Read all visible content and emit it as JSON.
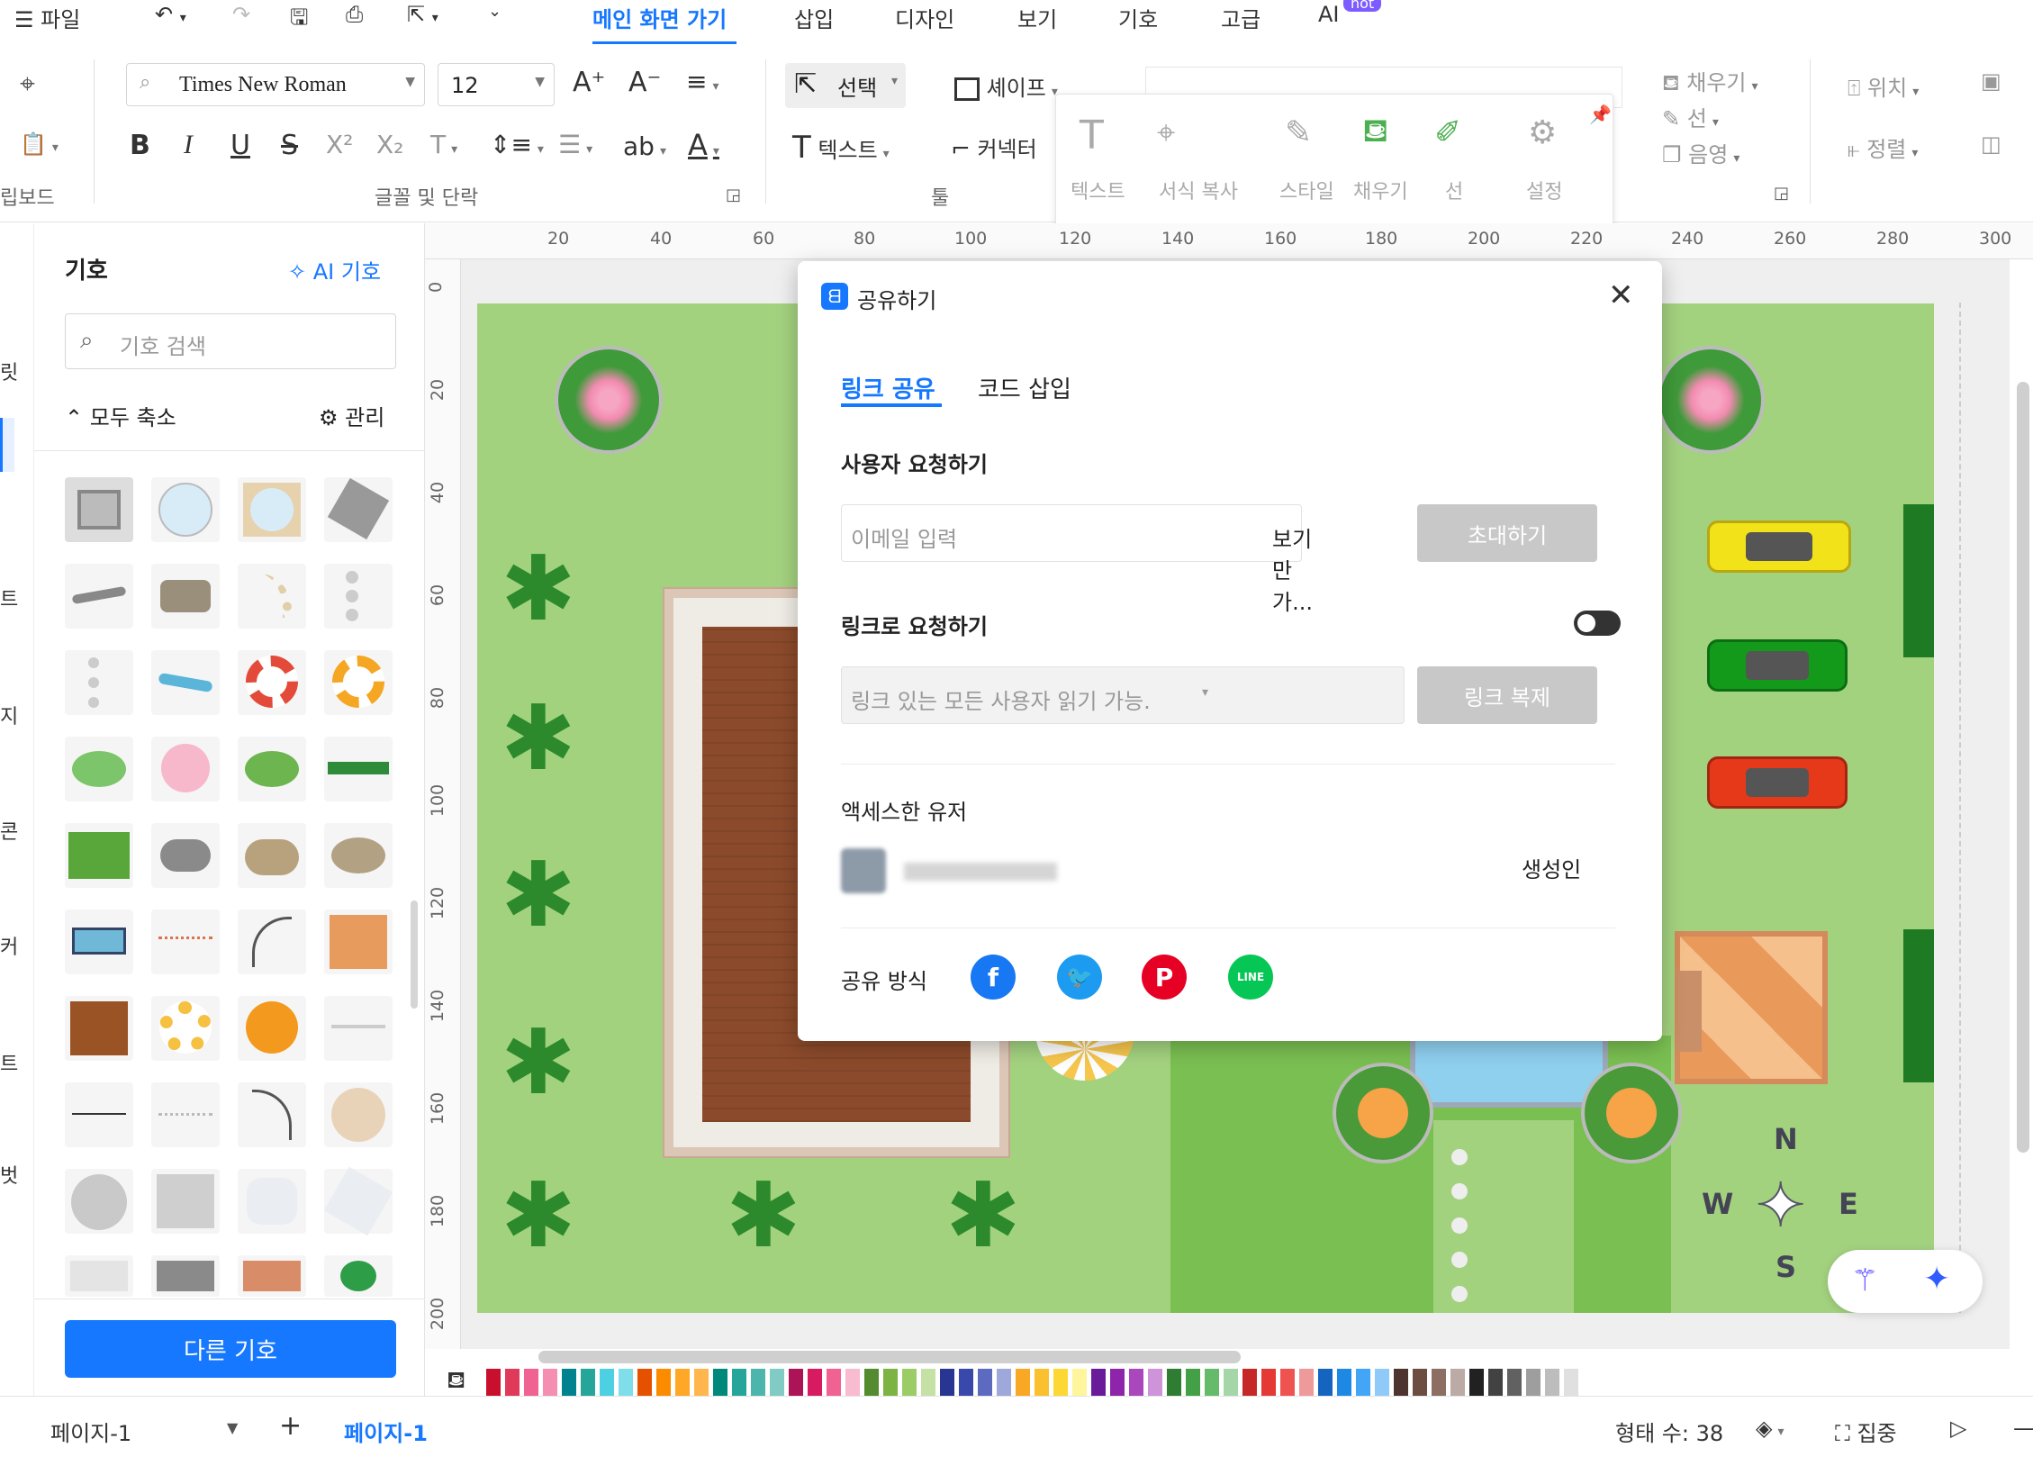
{
  "menu": {
    "file": "파일",
    "items": [
      "메인 화면 가기",
      "삽입",
      "디자인",
      "보기",
      "기호",
      "고급",
      "AI"
    ],
    "ai_badge": "hot"
  },
  "ribbon": {
    "font_family": "Times New Roman",
    "font_size": "12",
    "group_labels": [
      "립보드",
      "글꼴 및 단락",
      "툴"
    ],
    "select_label": "선택",
    "shape_label": "셰이프",
    "text_label": "텍스트",
    "connector_label": "커넥터",
    "fill_label": "채우기",
    "line_label": "선",
    "shadow_label": "음영",
    "position_label": "위치",
    "align_label": "정렬",
    "ab_label": "ab"
  },
  "quickbar": {
    "items": [
      "텍스트",
      "서식 복사",
      "스타일",
      "채우기",
      "선",
      "설정"
    ]
  },
  "left_panel": {
    "title": "기호",
    "ai_symbols": "AI 기호",
    "search_placeholder": "기호 검색",
    "collapse_all": "모두 축소",
    "manage": "관리",
    "more_symbols": "다른 기호",
    "strip_chars": [
      "릿",
      "트",
      "지",
      "콘",
      "커",
      "트",
      "벗"
    ]
  },
  "rulers": {
    "h": [
      "20",
      "40",
      "60",
      "80",
      "100",
      "120",
      "140",
      "160",
      "180",
      "200",
      "220",
      "240",
      "260",
      "280",
      "300"
    ],
    "v": [
      "0",
      "20",
      "40",
      "60",
      "80",
      "100",
      "120",
      "140",
      "160",
      "180",
      "200"
    ]
  },
  "dialog": {
    "title": "공유하기",
    "tabs": [
      "링크 공유",
      "코드 삽입"
    ],
    "invite_heading": "사용자 요청하기",
    "email_placeholder": "이메일 입력",
    "permission": "보기만 가...",
    "invite_button": "초대하기",
    "link_heading": "링크로 요청하기",
    "link_access": "링크 있는 모든 사용자 읽기 가능.",
    "copy_link_button": "링크 복제",
    "accessed_users": "액세스한 유저",
    "user_role": "생성인",
    "share_via": "공유 방식",
    "socials": [
      "facebook-icon",
      "twitter-icon",
      "pinterest-icon",
      "line-icon"
    ]
  },
  "compass": {
    "n": "N",
    "w": "W",
    "e": "E",
    "s": "S"
  },
  "status": {
    "page_selector": "페이지-1",
    "active_page": "페이지-1",
    "shape_count": "형태 수: 38",
    "focus": "집중"
  },
  "colors": {
    "accent": "#1677ff",
    "lawn": "#a3d27f",
    "deck": "#8b4a2b",
    "facebook": "#1877f2",
    "twitter": "#1d9bf0",
    "pinterest": "#e60023",
    "line": "#06c755"
  }
}
